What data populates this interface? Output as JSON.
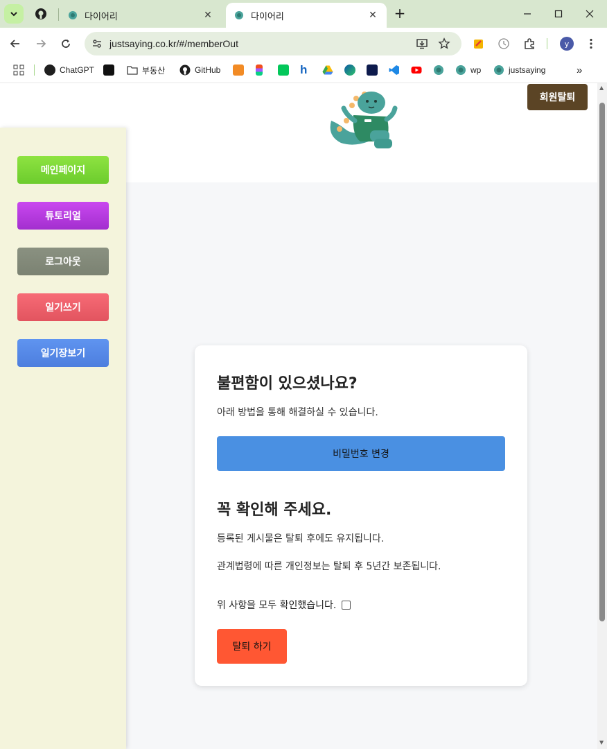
{
  "browser": {
    "tabs": [
      {
        "title": "다이어리",
        "active": false
      },
      {
        "title": "다이어리",
        "active": true
      }
    ],
    "new_tab_symbol": "+",
    "url": "justsaying.co.kr/#/memberOut",
    "profile_initial": "y",
    "bookmarks": [
      "ChatGPT",
      "부동산",
      "GitHub",
      "wp",
      "justsaying"
    ],
    "bookmark_overflow": "»",
    "icons": [
      "tab-list-icon",
      "github-icon",
      "tab-favicon",
      "back-icon",
      "forward-icon",
      "reload-icon",
      "site-info-icon",
      "install-app-icon",
      "bookmark-star-icon",
      "extensions-icon",
      "menu-icon",
      "minimize-icon",
      "maximize-icon",
      "close-icon"
    ]
  },
  "header": {
    "withdraw_label": "회원탈퇴"
  },
  "sidebar": {
    "items": [
      {
        "label": "메인페이지",
        "color": "#7ed63a"
      },
      {
        "label": "튜토리얼",
        "color": "#b43ee0"
      },
      {
        "label": "로그아웃",
        "color": "#848b7b"
      },
      {
        "label": "일기쓰기",
        "color": "#f0626e"
      },
      {
        "label": "일기장보기",
        "color": "#5589e8"
      }
    ]
  },
  "card": {
    "heading1": "불편함이 있으셨나요?",
    "desc1": "아래 방법을 통해 해결하실 수 있습니다.",
    "password_button": "비밀번호 변경",
    "heading2": "꼭 확인해 주세요.",
    "notice1": "등록된 게시물은 탈퇴 후에도 유지됩니다.",
    "notice2": "관계법령에 따른 개인정보는 탈퇴 후 5년간 보존됩니다.",
    "confirm_label": "위 사항을 모두 확인했습니다.",
    "confirm_checked": false,
    "leave_button": "탈퇴 하기"
  },
  "colors": {
    "withdraw_button": "#5b4425",
    "password_button": "#4a90e2",
    "leave_button": "#ff5733",
    "sidebar_bg": "#f4f4dc"
  }
}
